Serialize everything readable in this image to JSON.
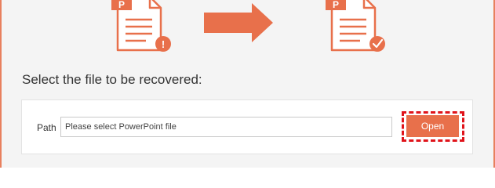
{
  "recovery": {
    "heading": "Select the file to be recovered:",
    "path_label": "Path",
    "path_value": "",
    "path_placeholder": "Please select PowerPoint file",
    "open_label": "Open"
  },
  "illustration": {
    "source_badge": "P",
    "target_badge": "P",
    "source_status_glyph": "!",
    "source_status": "error-icon",
    "target_status": "checkmark-icon",
    "arrow": "arrow-right-icon"
  },
  "colors": {
    "accent": "#e8704b",
    "frame": "#e8805e",
    "focus_ring": "#e0131a",
    "panel_bg": "#f4f4f4"
  }
}
